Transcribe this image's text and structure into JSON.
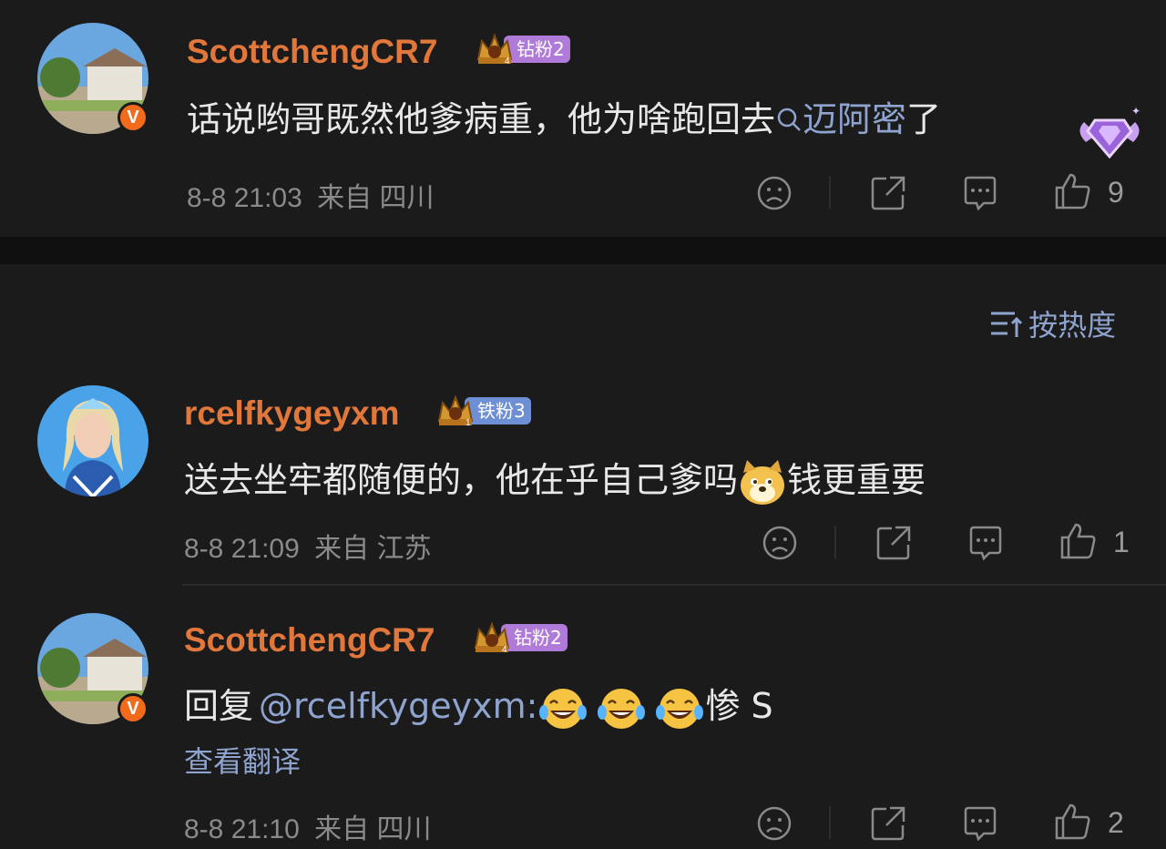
{
  "comments": [
    {
      "username": "ScottchengCR7",
      "fan_badge": {
        "label": "钻粉2",
        "level": "4"
      },
      "verified_badge": "V",
      "text_prefix": "话说哟哥既然他爹病重，他为啥跑回去",
      "search_link": "迈阿密",
      "text_suffix": "了",
      "time": "8-8 21:03",
      "location": "来自 四川",
      "like_count": "9"
    },
    {
      "username": "rcelfkygeyxm",
      "fan_badge": {
        "label": "铁粉3",
        "level": "1"
      },
      "text_prefix": "送去坐牢都随便的，他在乎自己爹吗",
      "text_suffix": "钱更重要",
      "time": "8-8 21:09",
      "location": "来自 江苏",
      "like_count": "1"
    },
    {
      "username": "ScottchengCR7",
      "fan_badge": {
        "label": "钻粉2",
        "level": "4"
      },
      "verified_badge": "V",
      "reply_prefix": "回复",
      "mention": "@rcelfkygeyxm:",
      "text_suffix": "惨 S",
      "translate": "查看翻译",
      "time": "8-8 21:10",
      "location": "来自 四川",
      "like_count": "2"
    }
  ],
  "sort_label": "按热度",
  "colors": {
    "background": "#1b1b1b",
    "username": "#e2773c",
    "link": "#8fa3cf",
    "diamond_badge": "#b07ad8",
    "iron_badge": "#6f8fd4",
    "verified": "#f26b1d"
  },
  "icons": [
    "dislike-icon",
    "share-icon",
    "comment-icon",
    "like-icon",
    "sort-icon",
    "search-icon",
    "doge-emoji",
    "laugh-cry-emoji",
    "diamond-fan-decoration"
  ]
}
